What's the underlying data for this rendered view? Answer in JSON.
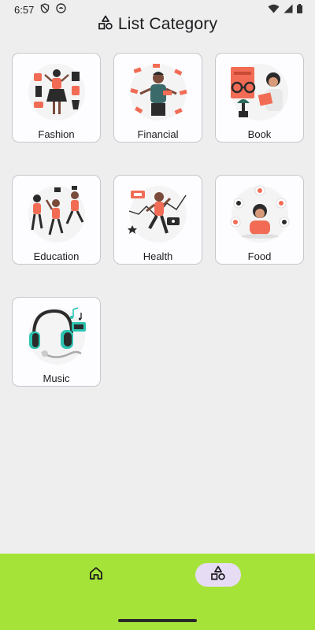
{
  "status_bar": {
    "time": "6:57",
    "icons": [
      "shield-icon",
      "cat-icon",
      "wifi-icon",
      "signal-icon",
      "battery-icon"
    ]
  },
  "header": {
    "title": "List Category",
    "icon": "category-shapes-icon"
  },
  "categories": [
    {
      "label": "Fashion",
      "icon": "fashion-illustration"
    },
    {
      "label": "Financial",
      "icon": "financial-illustration"
    },
    {
      "label": "Book",
      "icon": "book-illustration"
    },
    {
      "label": "Education",
      "icon": "education-illustration"
    },
    {
      "label": "Health",
      "icon": "health-illustration"
    },
    {
      "label": "Food",
      "icon": "food-illustration"
    },
    {
      "label": "Music",
      "icon": "music-illustration"
    }
  ],
  "bottom_nav": {
    "items": [
      {
        "icon": "home-icon",
        "selected": false
      },
      {
        "icon": "category-shapes-icon",
        "selected": true
      }
    ]
  },
  "colors": {
    "accent": "#f26c55",
    "nav_background": "#a6e339",
    "nav_selected_pill": "#e6dcf4",
    "music_accent": "#2dc4b2"
  }
}
